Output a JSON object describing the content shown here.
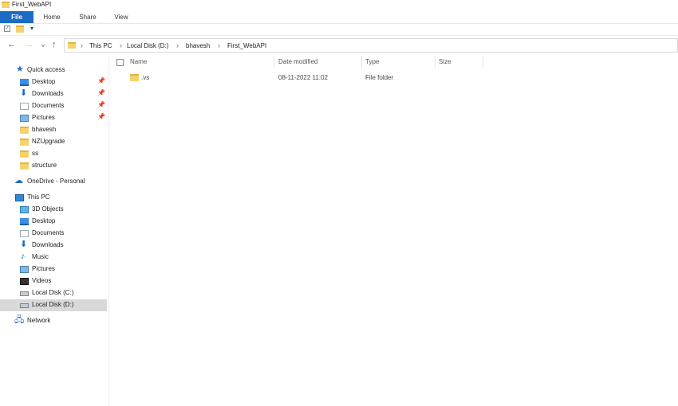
{
  "window": {
    "title": "First_WebAPI"
  },
  "ribbon": {
    "tabs": [
      "File",
      "Home",
      "Share",
      "View"
    ]
  },
  "quick_access_toolbar": {
    "icons": [
      "properties-icon",
      "new-folder-icon",
      "customize-dropdown-icon"
    ]
  },
  "navigation": {
    "back": "←",
    "forward": "→",
    "recent": "˅",
    "up": "↑"
  },
  "address_bar": {
    "separator": "›",
    "breadcrumbs": [
      "This PC",
      "Local Disk (D:)",
      "bhavesh",
      "First_WebAPI"
    ]
  },
  "sidebar": {
    "quick_access_label": "Quick access",
    "quick_access_items": [
      {
        "label": "Desktop",
        "icon": "desktop-icon",
        "pinned": true
      },
      {
        "label": "Downloads",
        "icon": "downloads-icon",
        "pinned": true
      },
      {
        "label": "Documents",
        "icon": "documents-icon",
        "pinned": true
      },
      {
        "label": "Pictures",
        "icon": "pictures-icon",
        "pinned": true
      },
      {
        "label": "bhavesh",
        "icon": "folder-icon",
        "pinned": false
      },
      {
        "label": "NZUpgrade",
        "icon": "folder-icon",
        "pinned": false
      },
      {
        "label": "ss",
        "icon": "folder-icon",
        "pinned": false
      },
      {
        "label": "structure",
        "icon": "folder-icon",
        "pinned": false
      }
    ],
    "onedrive_label": "OneDrive - Personal",
    "this_pc_label": "This PC",
    "this_pc_items": [
      {
        "label": "3D Objects",
        "icon": "3d-objects-icon"
      },
      {
        "label": "Desktop",
        "icon": "desktop-icon"
      },
      {
        "label": "Documents",
        "icon": "documents-icon"
      },
      {
        "label": "Downloads",
        "icon": "downloads-icon"
      },
      {
        "label": "Music",
        "icon": "music-icon"
      },
      {
        "label": "Pictures",
        "icon": "pictures-icon"
      },
      {
        "label": "Videos",
        "icon": "videos-icon"
      },
      {
        "label": "Local Disk (C:)",
        "icon": "drive-icon"
      },
      {
        "label": "Local Disk (D:)",
        "icon": "drive-icon",
        "selected": true
      }
    ],
    "network_label": "Network"
  },
  "file_list": {
    "columns": {
      "name": "Name",
      "date": "Date modified",
      "type": "Type",
      "size": "Size"
    },
    "rows": [
      {
        "name": ".vs",
        "date": "08-11-2022 11:02",
        "type": "File folder",
        "size": ""
      }
    ]
  },
  "colors": {
    "accent": "#1e6bc4",
    "folder": "#f5d36b",
    "selection": "#d9d9d9"
  }
}
